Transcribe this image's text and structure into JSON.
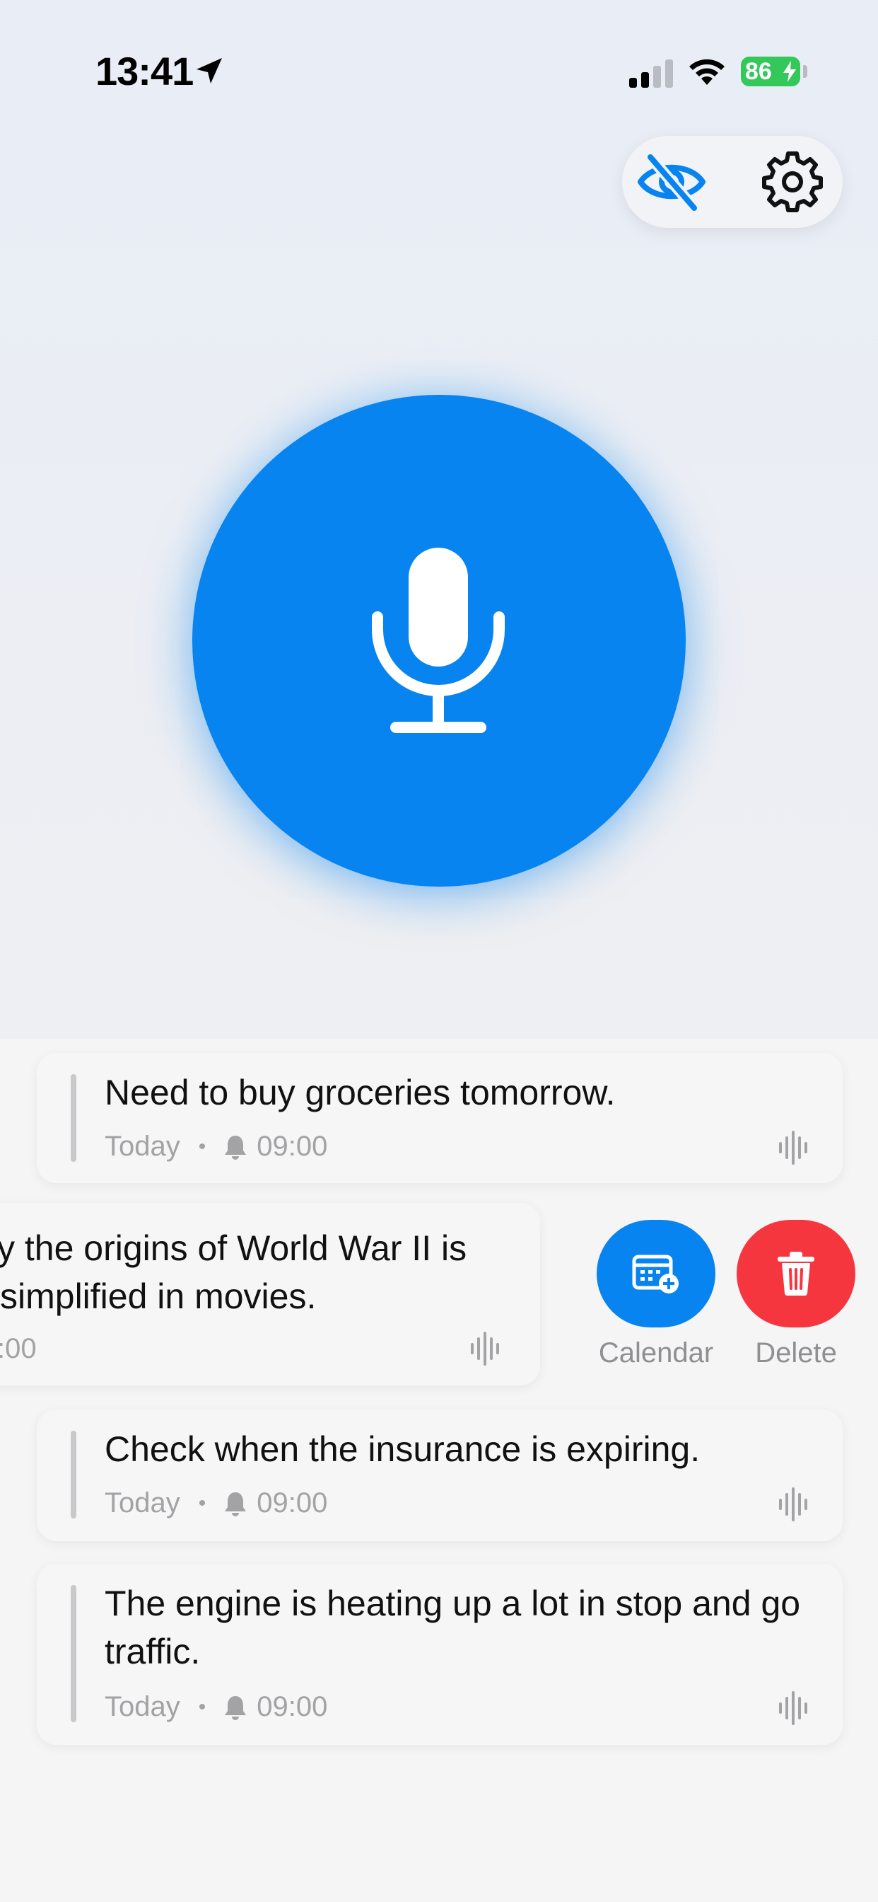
{
  "status_bar": {
    "time": "13:41",
    "battery": "86"
  },
  "icons": {
    "location": "location-arrow-icon",
    "signal": "cellular-signal-icon",
    "wifi": "wifi-icon",
    "visibility": "eye-slash-icon",
    "settings": "gear-icon",
    "mic": "microphone-icon",
    "bell": "bell-icon",
    "waveform": "waveform-icon",
    "calendar": "calendar-add-icon",
    "trash": "trash-icon"
  },
  "colors": {
    "accent": "#0784ef",
    "delete": "#f6363f",
    "battery": "#34c759"
  },
  "notes": [
    {
      "text": "Need to buy groceries tomorrow.",
      "day": "Today",
      "time": "09:00"
    },
    {
      "text_line1": "y the origins of World War II is",
      "text_line2": "simplified in movies.",
      "time_partial": ":00"
    },
    {
      "text": "Check when the insurance is expiring.",
      "day": "Today",
      "time": "09:00"
    },
    {
      "text": "The engine is heating up a lot in stop and go traffic.",
      "day": "Today",
      "time": "09:00"
    }
  ],
  "swipe_actions": {
    "calendar_label": "Calendar",
    "delete_label": "Delete"
  }
}
